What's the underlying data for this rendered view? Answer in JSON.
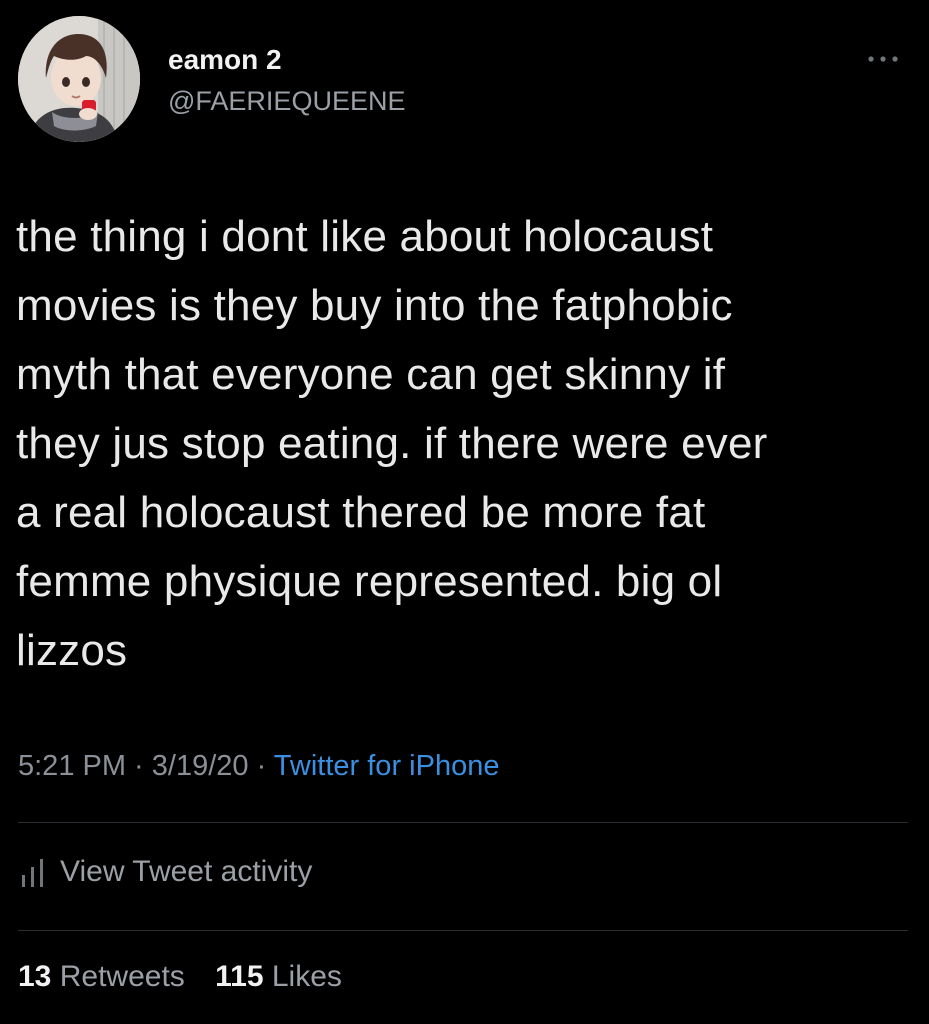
{
  "author": {
    "display_name": "eamon 2",
    "handle": "@FAERIEQUEENE",
    "avatar_icon": "anime-character-avatar"
  },
  "more_icon": "more-horizontal-icon",
  "tweet": {
    "lines": [
      "the thing i dont like about holocaust",
      "movies is they buy into the fatphobic",
      "myth that everyone can get skinny if",
      "they jus stop eating. if there were ever",
      "a real holocaust thered be more fat",
      "femme physique represented. big ol",
      "lizzos"
    ]
  },
  "meta": {
    "time": "5:21 PM",
    "separator": " · ",
    "date": "3/19/20",
    "source": "Twitter for iPhone"
  },
  "activity": {
    "icon": "bar-chart-icon",
    "label": "View Tweet activity"
  },
  "stats": {
    "retweets_count": "13",
    "retweets_label": "Retweets",
    "likes_count": "115",
    "likes_label": "Likes"
  },
  "colors": {
    "background": "#000000",
    "link": "#3b8fe0",
    "secondary_text": "#9aa0a6"
  }
}
